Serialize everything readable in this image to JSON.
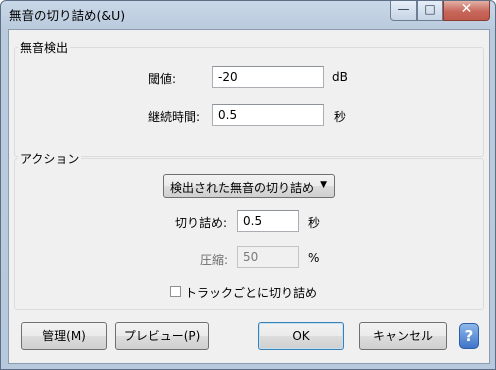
{
  "window": {
    "title": "無音の切り詰め(&U)",
    "minimize_glyph": "—",
    "maximize_glyph": "□",
    "close_glyph": "✕"
  },
  "detect": {
    "group_title": "無音検出",
    "threshold_label": "閾値:",
    "threshold_value": "-20",
    "threshold_unit": "dB",
    "duration_label": "継続時間:",
    "duration_value": "0.5",
    "duration_unit": "秒"
  },
  "action": {
    "group_title": "アクション",
    "mode_selected": "検出された無音の切り詰め",
    "truncate_label": "切り詰め:",
    "truncate_value": "0.5",
    "truncate_unit": "秒",
    "compress_label": "圧縮:",
    "compress_value": "50",
    "compress_unit": "%",
    "per_track_label": "トラックごとに切り詰め",
    "per_track_checked": false
  },
  "buttons": {
    "manage": "管理(M)",
    "preview": "プレビュー(P)",
    "ok": "OK",
    "cancel": "キャンセル",
    "help": "?"
  }
}
